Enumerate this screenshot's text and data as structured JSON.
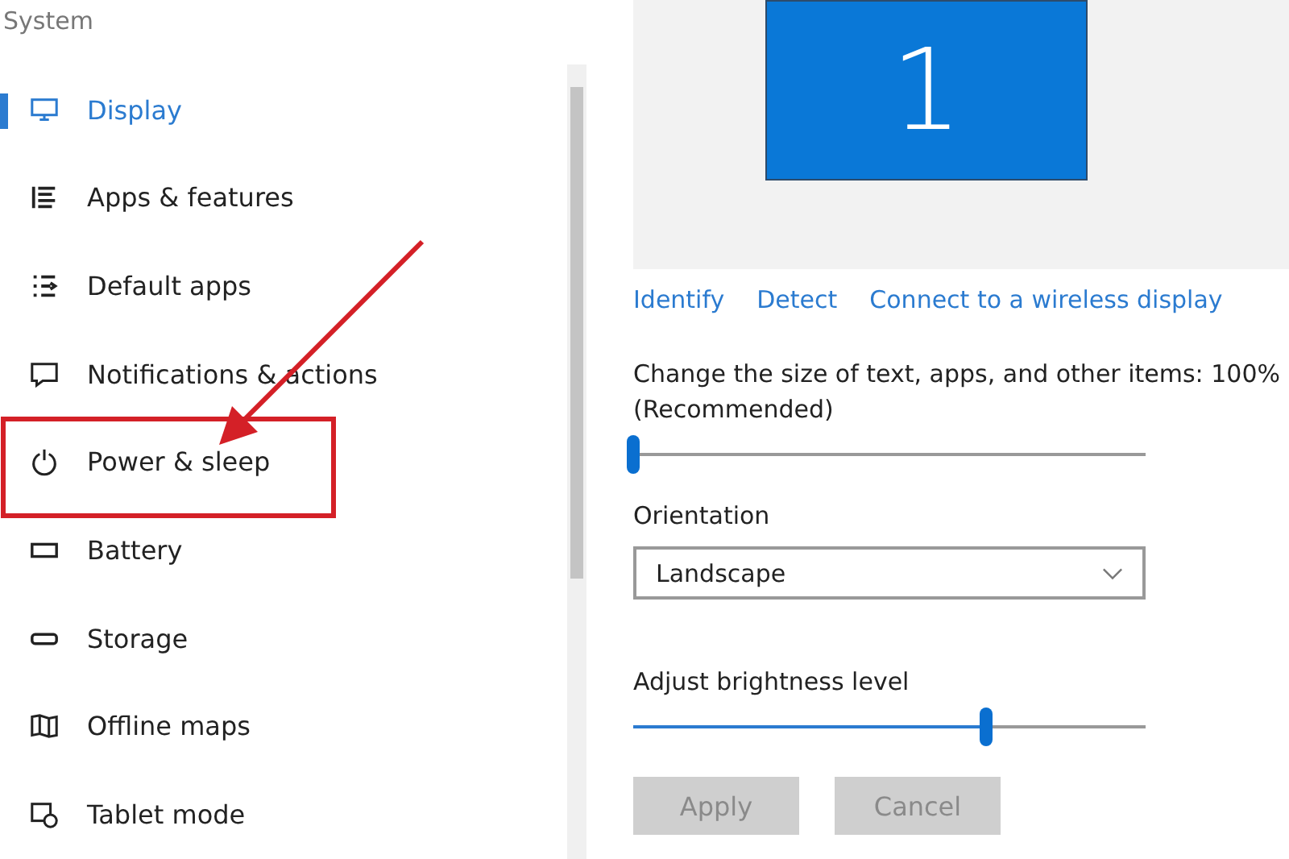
{
  "window": {
    "title": "System"
  },
  "sidebar": {
    "items": [
      {
        "label": "Display",
        "selected": true
      },
      {
        "label": "Apps & features",
        "selected": false
      },
      {
        "label": "Default apps",
        "selected": false
      },
      {
        "label": "Notifications & actions",
        "selected": false
      },
      {
        "label": "Power & sleep",
        "selected": false
      },
      {
        "label": "Battery",
        "selected": false
      },
      {
        "label": "Storage",
        "selected": false
      },
      {
        "label": "Offline maps",
        "selected": false
      },
      {
        "label": "Tablet mode",
        "selected": false
      }
    ]
  },
  "display": {
    "monitor_label": "1",
    "links": [
      "Identify",
      "Detect",
      "Connect to a wireless display"
    ],
    "scale": {
      "label": "Change the size of text, apps, and other items: 100% (Recommended)",
      "level": 0.0
    },
    "orientation": {
      "label": "Orientation",
      "value": "Landscape"
    },
    "brightness": {
      "label": "Adjust brightness level",
      "level": 0.69
    },
    "buttons": [
      {
        "label": "Apply",
        "disabled": true
      },
      {
        "label": "Cancel",
        "disabled": true
      }
    ]
  }
}
